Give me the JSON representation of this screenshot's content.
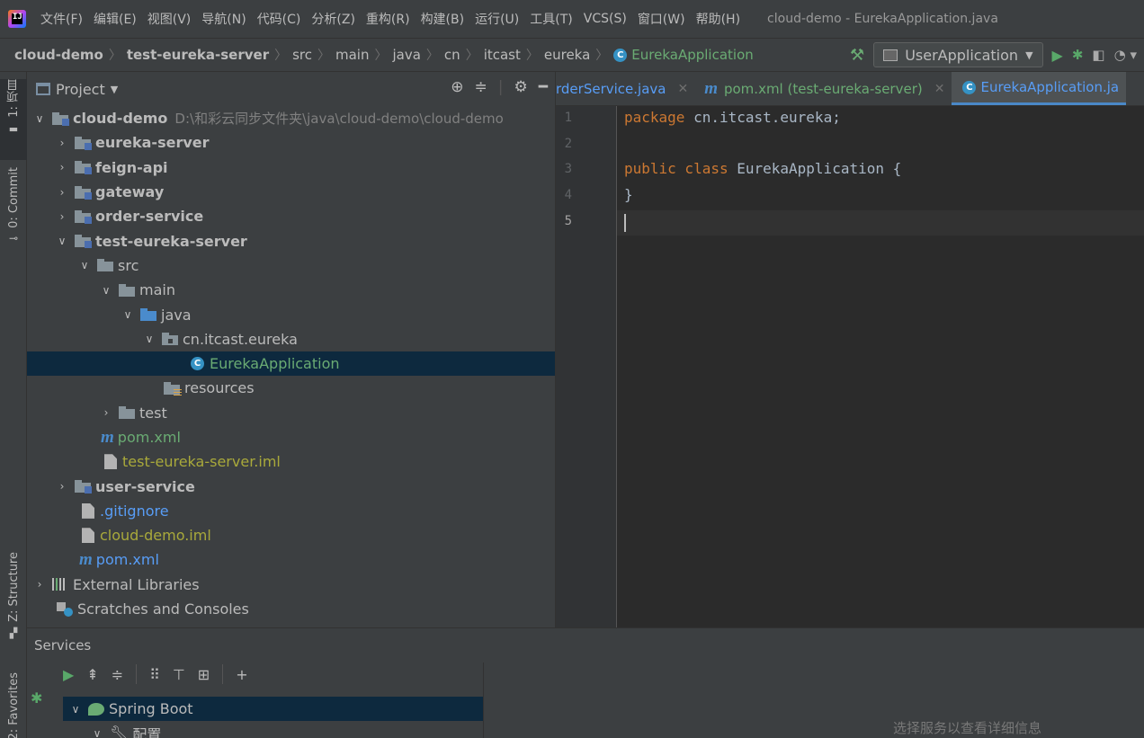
{
  "menubar": {
    "logo": "IJ",
    "items": [
      "文件(F)",
      "编辑(E)",
      "视图(V)",
      "导航(N)",
      "代码(C)",
      "分析(Z)",
      "重构(R)",
      "构建(B)",
      "运行(U)",
      "工具(T)",
      "VCS(S)",
      "窗口(W)",
      "帮助(H)"
    ],
    "window_title": "cloud-demo - EurekaApplication.java"
  },
  "breadcrumb": {
    "items": [
      "cloud-demo",
      "test-eureka-server",
      "src",
      "main",
      "java",
      "cn",
      "itcast",
      "eureka"
    ],
    "active": "EurekaApplication"
  },
  "run_config": {
    "label": "UserApplication"
  },
  "left_strip": {
    "project_tab": "1: 项目",
    "commit_tab": "0: Commit",
    "structure_tab": "Z: Structure",
    "favorites_tab": "2: Favorites"
  },
  "project_panel": {
    "title": "Project",
    "tree": [
      {
        "label": "cloud-demo",
        "path": "D:\\和彩云同步文件夹\\java\\cloud-demo\\cloud-demo"
      },
      {
        "label": "eureka-server"
      },
      {
        "label": "feign-api"
      },
      {
        "label": "gateway"
      },
      {
        "label": "order-service"
      },
      {
        "label": "test-eureka-server"
      },
      {
        "label": "src"
      },
      {
        "label": "main"
      },
      {
        "label": "java"
      },
      {
        "label": "cn.itcast.eureka"
      },
      {
        "label": "EurekaApplication"
      },
      {
        "label": "resources"
      },
      {
        "label": "test"
      },
      {
        "label": "pom.xml"
      },
      {
        "label": "test-eureka-server.iml"
      },
      {
        "label": "user-service"
      },
      {
        "label": ".gitignore"
      },
      {
        "label": "cloud-demo.iml"
      },
      {
        "label": "pom.xml"
      },
      {
        "label": "External Libraries"
      },
      {
        "label": "Scratches and Consoles"
      }
    ]
  },
  "editor": {
    "tabs": [
      {
        "label": "rderService.java"
      },
      {
        "label": "pom.xml (test-eureka-server)"
      },
      {
        "label": "EurekaApplication.ja"
      }
    ],
    "line_numbers": [
      "1",
      "2",
      "3",
      "4",
      "5"
    ],
    "code": {
      "l1_kw": "package",
      "l1_rest": " cn.itcast.eureka;",
      "l3_kw": "public class",
      "l3_rest": " EurekaApplication {",
      "l4": "}"
    }
  },
  "services": {
    "title": "Services",
    "tree": [
      {
        "label": "Spring Boot"
      },
      {
        "label": "配置"
      }
    ],
    "hint": "选择服务以查看详细信息"
  },
  "colors": {
    "accent": "#4a88c7",
    "selection": "#0d293e",
    "keyword": "#cc7832",
    "green": "#6aab73"
  }
}
